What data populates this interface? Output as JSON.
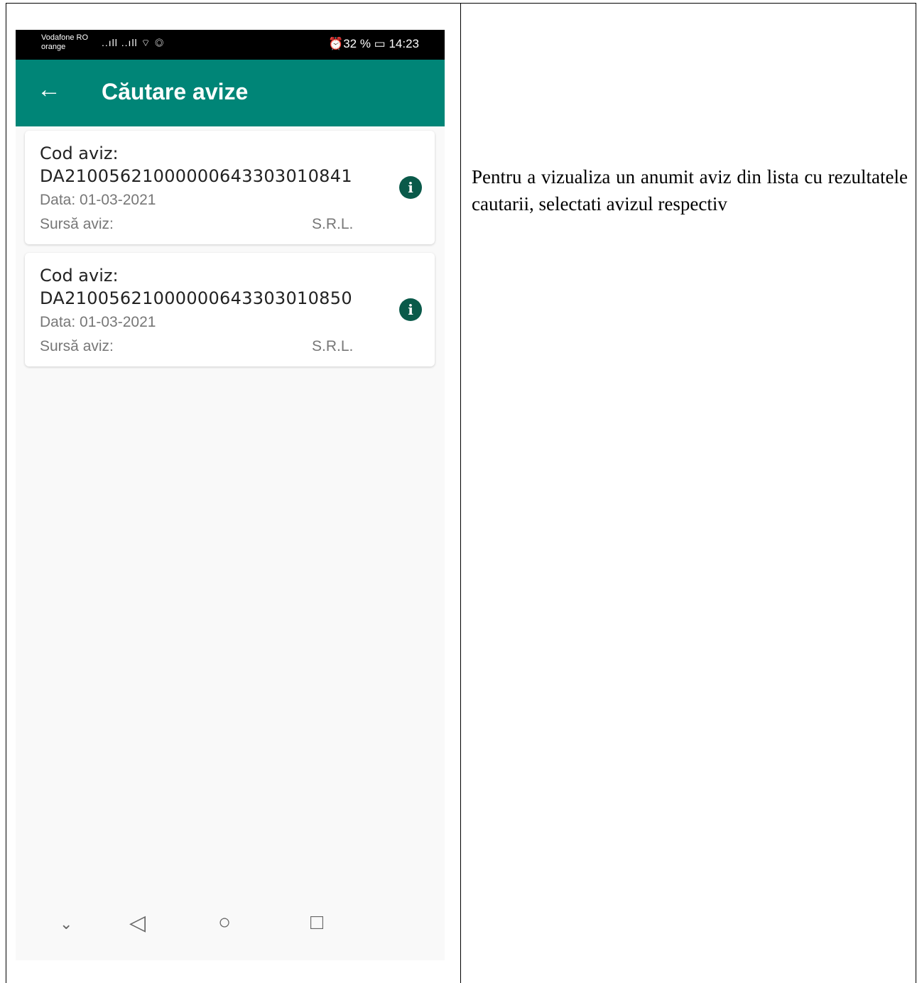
{
  "status_bar": {
    "carrier_line1": "Vodafone RO",
    "carrier_line2": "orange",
    "signal_icons": "..ıll ..ıll ⌔ ◎",
    "right_text": "⏰32 % ▭ 14:23"
  },
  "app_bar": {
    "back_icon": "←",
    "title": "Căutare avize"
  },
  "results": [
    {
      "label": "Cod aviz:",
      "code": "DA21005621000000643303010841",
      "date": "Data: 01-03-2021",
      "source_label": "Sursă aviz:",
      "source_suffix": "S.R.L.",
      "info_icon": "i"
    },
    {
      "label": "Cod aviz:",
      "code": "DA21005621000000643303010850",
      "date": "Data: 01-03-2021",
      "source_label": "Sursă aviz:",
      "source_suffix": "S.R.L.",
      "info_icon": "i"
    }
  ],
  "nav_bar": {
    "chevron": "⌄",
    "back": "◁",
    "home": "○",
    "recent": "□"
  },
  "description": "Pentru a vizualiza un anumit aviz din lista cu rezultatele cautarii, selectati avizul respectiv",
  "colors": {
    "app_bar": "#008577",
    "info_icon": "#0a5a4a"
  }
}
